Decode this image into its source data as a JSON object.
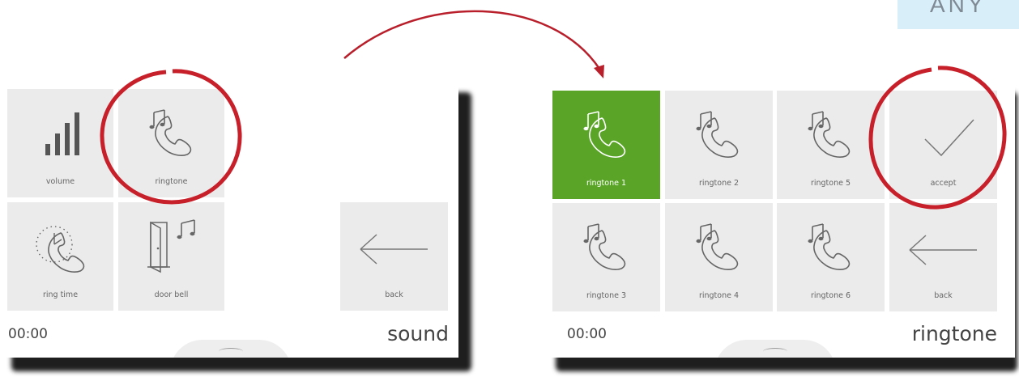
{
  "corner_text": "ANY",
  "left_screen": {
    "tiles": [
      {
        "label": "volume",
        "icon": "volume-bars-icon"
      },
      {
        "label": "ringtone",
        "icon": "ringtone-phone-icon"
      },
      {
        "label": "ring time",
        "icon": "ring-time-icon"
      },
      {
        "label": "door bell",
        "icon": "door-bell-icon"
      },
      {
        "label": "back",
        "icon": "back-arrow-icon"
      }
    ],
    "clock": "00:00",
    "title": "sound"
  },
  "right_screen": {
    "tiles": [
      {
        "label": "ringtone 1",
        "icon": "ringtone-phone-icon",
        "selected": true
      },
      {
        "label": "ringtone 2",
        "icon": "ringtone-phone-icon"
      },
      {
        "label": "ringtone 5",
        "icon": "ringtone-phone-icon"
      },
      {
        "label": "accept",
        "icon": "checkmark-icon"
      },
      {
        "label": "ringtone 3",
        "icon": "ringtone-phone-icon"
      },
      {
        "label": "ringtone 4",
        "icon": "ringtone-phone-icon"
      },
      {
        "label": "ringtone 6",
        "icon": "ringtone-phone-icon"
      },
      {
        "label": "back",
        "icon": "back-arrow-icon"
      }
    ],
    "clock": "00:00",
    "title": "ringtone"
  },
  "colors": {
    "selected": "#5aa528",
    "highlight_circle": "#c8202a",
    "tile": "#ebebeb"
  }
}
